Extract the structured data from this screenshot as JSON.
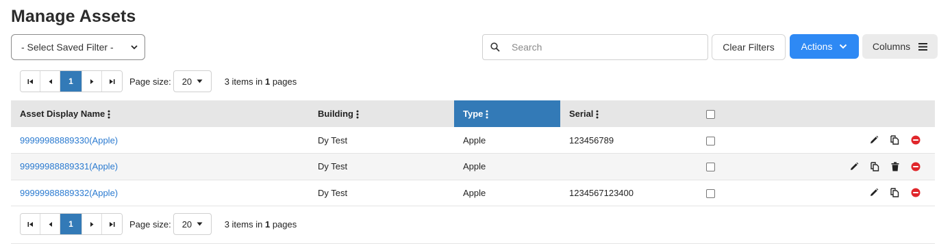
{
  "page": {
    "title": "Manage Assets"
  },
  "filter": {
    "selected": "- Select Saved Filter -"
  },
  "search": {
    "placeholder": "Search",
    "value": ""
  },
  "toolbar": {
    "clear_label": "Clear Filters",
    "actions_label": "Actions",
    "columns_label": "Columns"
  },
  "pager": {
    "current_page": "1",
    "page_size_label": "Page size:",
    "page_size": "20",
    "items_prefix": "3 items in",
    "total_pages": "1",
    "pages_suffix": "pages"
  },
  "table": {
    "headers": {
      "name": "Asset Display Name",
      "building": "Building",
      "type": "Type",
      "serial": "Serial"
    },
    "sorted_column": "Type",
    "rows": [
      {
        "name": "99999988889330(Apple)",
        "building": "Dy Test",
        "type": "Apple",
        "serial": "123456789",
        "actions": [
          "edit-icon",
          "copy-icon",
          "remove-icon"
        ]
      },
      {
        "name": "99999988889331(Apple)",
        "building": "Dy Test",
        "type": "Apple",
        "serial": "",
        "actions": [
          "edit-icon",
          "copy-icon",
          "trash-icon",
          "remove-icon"
        ]
      },
      {
        "name": "99999988889332(Apple)",
        "building": "Dy Test",
        "type": "Apple",
        "serial": "1234567123400",
        "actions": [
          "edit-icon",
          "copy-icon",
          "remove-icon"
        ]
      }
    ]
  },
  "colors": {
    "accent": "#2e89f4",
    "sorted_header": "#337ab7",
    "link": "#2a7ad0",
    "remove": "#e0262b"
  }
}
